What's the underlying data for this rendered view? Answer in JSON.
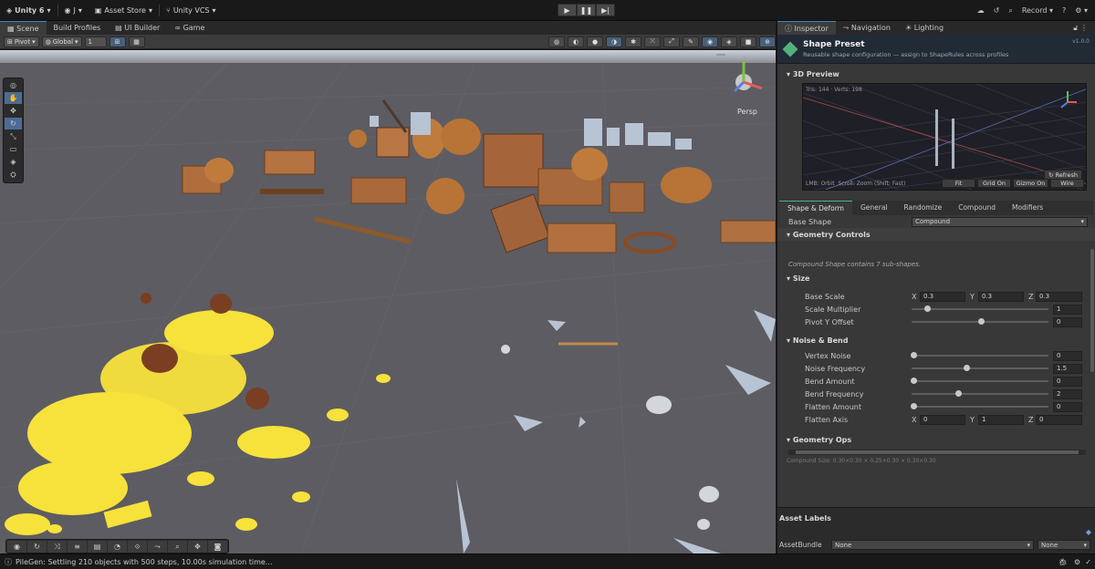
{
  "topbar": {
    "unity": "Unity 6",
    "account": "J",
    "asset_store": "Asset Store",
    "vcs": "Unity VCS",
    "record": "Record"
  },
  "tabs": [
    "Scene",
    "Build Profiles",
    "UI Builder",
    "Game"
  ],
  "scenebar": {
    "pivot": "Pivot",
    "global": "Global",
    "snap_value": "1"
  },
  "viewport": {
    "persp_label": "Persp"
  },
  "inspector": {
    "tabs": [
      "Inspector",
      "Navigation",
      "Lighting"
    ],
    "title": "Shape Preset",
    "subtitle": "Reusable shape configuration — assign to ShapeRules across profiles",
    "version": "v1.0.0",
    "preview_label": "3D Preview",
    "preview_stats": "Tris: 144 · Verts: 198",
    "preview_hint": "LMB: Orbit  Scroll: Zoom (Shift: Fast)",
    "preview_buttons": [
      "Fit",
      "Grid On",
      "Gizmo On",
      "Wire"
    ],
    "refresh": "Refresh",
    "sub_tabs": [
      "Shape & Deform",
      "General",
      "Randomize",
      "Compound",
      "Modifiers"
    ],
    "base_shape_label": "Base Shape",
    "base_shape_value": "Compound",
    "geometry_controls": "Geometry Controls",
    "compound_note": "Compound Shape contains 7 sub-shapes.",
    "size_section": "Size",
    "base_scale_label": "Base Scale",
    "base_scale": {
      "x": "0.3",
      "y": "0.3",
      "z": "0.3"
    },
    "scale_multiplier_label": "Scale Multiplier",
    "scale_multiplier": "1",
    "pivot_y_label": "Pivot Y Offset",
    "pivot_y": "0",
    "noise_section": "Noise & Bend",
    "vertex_noise_label": "Vertex Noise",
    "vertex_noise": "0",
    "noise_freq_label": "Noise Frequency",
    "noise_freq": "1.5",
    "bend_amount_label": "Bend Amount",
    "bend_amount": "0",
    "bend_freq_label": "Bend Frequency",
    "bend_freq": "2",
    "flatten_amount_label": "Flatten Amount",
    "flatten_amount": "0",
    "flatten_axis_label": "Flatten Axis",
    "flatten_axis": {
      "x": "0",
      "y": "1",
      "z": "0"
    },
    "geometry_ops": "Geometry Ops",
    "compound_size": "Compound Size: 0.30×0.30 × 0.25×0.30 × 0.30×0.30",
    "asset_labels": "Asset Labels",
    "assetbundle_label": "AssetBundle",
    "assetbundle_value": "None",
    "assetbundle_variant": "None"
  },
  "status": {
    "message": "PileGen: Settling 210 objects with 500 steps, 10.00s simulation time..."
  }
}
